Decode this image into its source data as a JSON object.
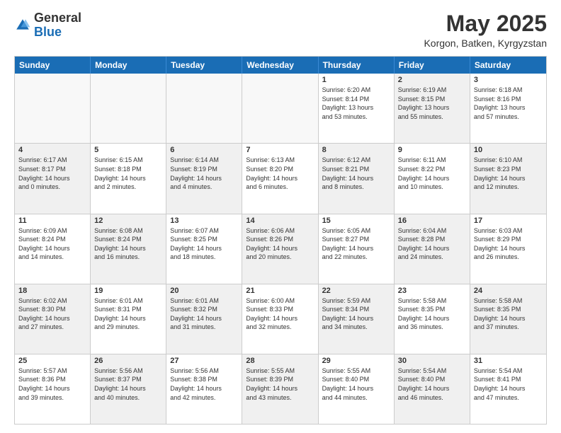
{
  "logo": {
    "general": "General",
    "blue": "Blue"
  },
  "title": "May 2025",
  "location": "Korgon, Batken, Kyrgyzstan",
  "days_of_week": [
    "Sunday",
    "Monday",
    "Tuesday",
    "Wednesday",
    "Thursday",
    "Friday",
    "Saturday"
  ],
  "weeks": [
    [
      {
        "day": "",
        "empty": true
      },
      {
        "day": "",
        "empty": true
      },
      {
        "day": "",
        "empty": true
      },
      {
        "day": "",
        "empty": true
      },
      {
        "day": "1",
        "lines": [
          "Sunrise: 6:20 AM",
          "Sunset: 8:14 PM",
          "Daylight: 13 hours",
          "and 53 minutes."
        ]
      },
      {
        "day": "2",
        "lines": [
          "Sunrise: 6:19 AM",
          "Sunset: 8:15 PM",
          "Daylight: 13 hours",
          "and 55 minutes."
        ]
      },
      {
        "day": "3",
        "lines": [
          "Sunrise: 6:18 AM",
          "Sunset: 8:16 PM",
          "Daylight: 13 hours",
          "and 57 minutes."
        ]
      }
    ],
    [
      {
        "day": "4",
        "lines": [
          "Sunrise: 6:17 AM",
          "Sunset: 8:17 PM",
          "Daylight: 14 hours",
          "and 0 minutes."
        ]
      },
      {
        "day": "5",
        "lines": [
          "Sunrise: 6:15 AM",
          "Sunset: 8:18 PM",
          "Daylight: 14 hours",
          "and 2 minutes."
        ]
      },
      {
        "day": "6",
        "lines": [
          "Sunrise: 6:14 AM",
          "Sunset: 8:19 PM",
          "Daylight: 14 hours",
          "and 4 minutes."
        ]
      },
      {
        "day": "7",
        "lines": [
          "Sunrise: 6:13 AM",
          "Sunset: 8:20 PM",
          "Daylight: 14 hours",
          "and 6 minutes."
        ]
      },
      {
        "day": "8",
        "lines": [
          "Sunrise: 6:12 AM",
          "Sunset: 8:21 PM",
          "Daylight: 14 hours",
          "and 8 minutes."
        ]
      },
      {
        "day": "9",
        "lines": [
          "Sunrise: 6:11 AM",
          "Sunset: 8:22 PM",
          "Daylight: 14 hours",
          "and 10 minutes."
        ]
      },
      {
        "day": "10",
        "lines": [
          "Sunrise: 6:10 AM",
          "Sunset: 8:23 PM",
          "Daylight: 14 hours",
          "and 12 minutes."
        ]
      }
    ],
    [
      {
        "day": "11",
        "lines": [
          "Sunrise: 6:09 AM",
          "Sunset: 8:24 PM",
          "Daylight: 14 hours",
          "and 14 minutes."
        ]
      },
      {
        "day": "12",
        "lines": [
          "Sunrise: 6:08 AM",
          "Sunset: 8:24 PM",
          "Daylight: 14 hours",
          "and 16 minutes."
        ]
      },
      {
        "day": "13",
        "lines": [
          "Sunrise: 6:07 AM",
          "Sunset: 8:25 PM",
          "Daylight: 14 hours",
          "and 18 minutes."
        ]
      },
      {
        "day": "14",
        "lines": [
          "Sunrise: 6:06 AM",
          "Sunset: 8:26 PM",
          "Daylight: 14 hours",
          "and 20 minutes."
        ]
      },
      {
        "day": "15",
        "lines": [
          "Sunrise: 6:05 AM",
          "Sunset: 8:27 PM",
          "Daylight: 14 hours",
          "and 22 minutes."
        ]
      },
      {
        "day": "16",
        "lines": [
          "Sunrise: 6:04 AM",
          "Sunset: 8:28 PM",
          "Daylight: 14 hours",
          "and 24 minutes."
        ]
      },
      {
        "day": "17",
        "lines": [
          "Sunrise: 6:03 AM",
          "Sunset: 8:29 PM",
          "Daylight: 14 hours",
          "and 26 minutes."
        ]
      }
    ],
    [
      {
        "day": "18",
        "lines": [
          "Sunrise: 6:02 AM",
          "Sunset: 8:30 PM",
          "Daylight: 14 hours",
          "and 27 minutes."
        ]
      },
      {
        "day": "19",
        "lines": [
          "Sunrise: 6:01 AM",
          "Sunset: 8:31 PM",
          "Daylight: 14 hours",
          "and 29 minutes."
        ]
      },
      {
        "day": "20",
        "lines": [
          "Sunrise: 6:01 AM",
          "Sunset: 8:32 PM",
          "Daylight: 14 hours",
          "and 31 minutes."
        ]
      },
      {
        "day": "21",
        "lines": [
          "Sunrise: 6:00 AM",
          "Sunset: 8:33 PM",
          "Daylight: 14 hours",
          "and 32 minutes."
        ]
      },
      {
        "day": "22",
        "lines": [
          "Sunrise: 5:59 AM",
          "Sunset: 8:34 PM",
          "Daylight: 14 hours",
          "and 34 minutes."
        ]
      },
      {
        "day": "23",
        "lines": [
          "Sunrise: 5:58 AM",
          "Sunset: 8:35 PM",
          "Daylight: 14 hours",
          "and 36 minutes."
        ]
      },
      {
        "day": "24",
        "lines": [
          "Sunrise: 5:58 AM",
          "Sunset: 8:35 PM",
          "Daylight: 14 hours",
          "and 37 minutes."
        ]
      }
    ],
    [
      {
        "day": "25",
        "lines": [
          "Sunrise: 5:57 AM",
          "Sunset: 8:36 PM",
          "Daylight: 14 hours",
          "and 39 minutes."
        ]
      },
      {
        "day": "26",
        "lines": [
          "Sunrise: 5:56 AM",
          "Sunset: 8:37 PM",
          "Daylight: 14 hours",
          "and 40 minutes."
        ]
      },
      {
        "day": "27",
        "lines": [
          "Sunrise: 5:56 AM",
          "Sunset: 8:38 PM",
          "Daylight: 14 hours",
          "and 42 minutes."
        ]
      },
      {
        "day": "28",
        "lines": [
          "Sunrise: 5:55 AM",
          "Sunset: 8:39 PM",
          "Daylight: 14 hours",
          "and 43 minutes."
        ]
      },
      {
        "day": "29",
        "lines": [
          "Sunrise: 5:55 AM",
          "Sunset: 8:40 PM",
          "Daylight: 14 hours",
          "and 44 minutes."
        ]
      },
      {
        "day": "30",
        "lines": [
          "Sunrise: 5:54 AM",
          "Sunset: 8:40 PM",
          "Daylight: 14 hours",
          "and 46 minutes."
        ]
      },
      {
        "day": "31",
        "lines": [
          "Sunrise: 5:54 AM",
          "Sunset: 8:41 PM",
          "Daylight: 14 hours",
          "and 47 minutes."
        ]
      }
    ]
  ]
}
